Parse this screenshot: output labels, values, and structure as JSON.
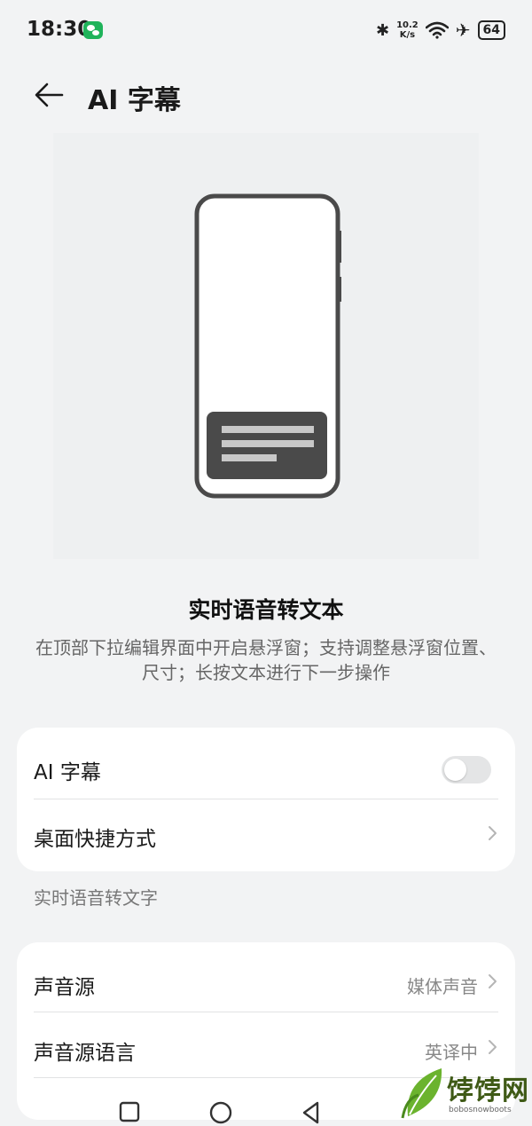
{
  "status_bar": {
    "time": "18:30",
    "speed_top": "10.2",
    "speed_bottom": "K/s",
    "battery": "64",
    "icons": [
      "wechat-icon",
      "bluetooth-icon",
      "wifi-icon",
      "airplane-icon",
      "battery-icon"
    ]
  },
  "header": {
    "title": "AI 字幕",
    "back_icon": "arrow-left-icon"
  },
  "feature": {
    "title": "实时语音转文本",
    "description": "在顶部下拉编辑界面中开启悬浮窗；支持调整悬浮窗位置、尺寸；长按文本进行下一步操作"
  },
  "card1": {
    "ai_subtitle_label": "AI 字幕",
    "ai_subtitle_enabled": false,
    "desktop_shortcut_label": "桌面快捷方式"
  },
  "section_label": "实时语音转文字",
  "card2": {
    "sound_source_label": "声音源",
    "sound_source_value": "媒体声音",
    "source_language_label": "声音源语言",
    "source_language_value": "英译中"
  },
  "watermark": {
    "text": "饽饽网",
    "sub": "bobosnowboots"
  },
  "colors": {
    "background": "#f2f3f4",
    "card": "#ffffff",
    "toggle_off": "#e4e5e6",
    "watermark_green": "#3f5a16"
  }
}
